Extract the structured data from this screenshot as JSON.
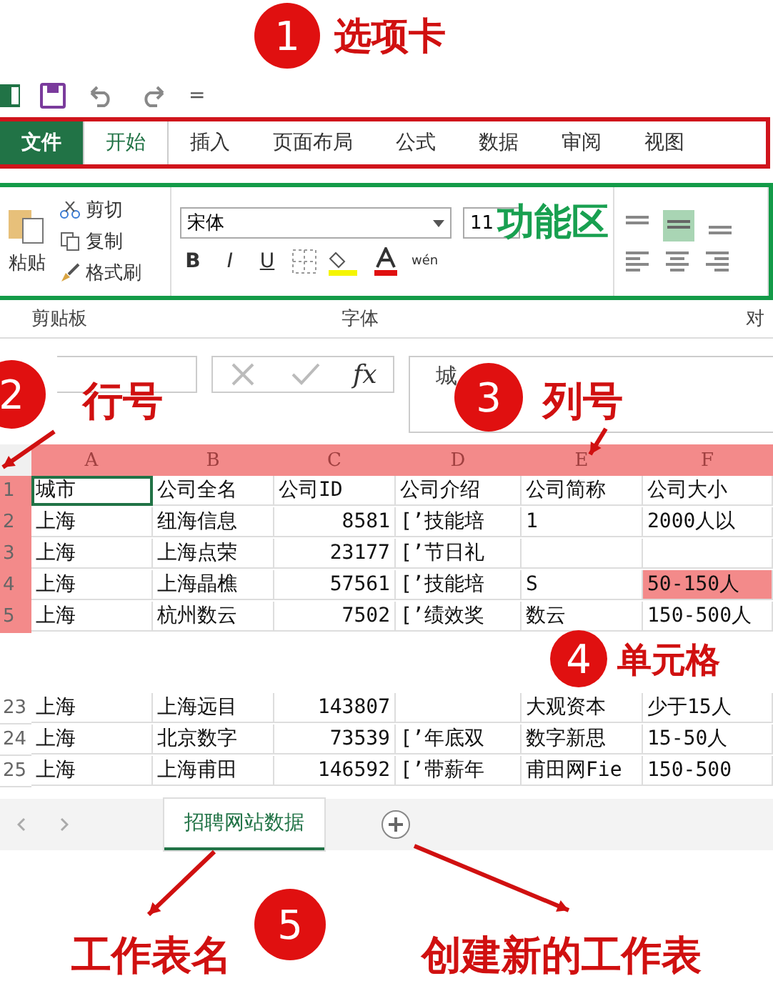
{
  "quick_access": {
    "customize": "="
  },
  "tabs": [
    {
      "label": "文件",
      "kind": "file",
      "selected": false
    },
    {
      "label": "开始",
      "kind": "tab",
      "selected": true
    },
    {
      "label": "插入",
      "kind": "tab",
      "selected": false
    },
    {
      "label": "页面布局",
      "kind": "tab",
      "selected": false
    },
    {
      "label": "公式",
      "kind": "tab",
      "selected": false
    },
    {
      "label": "数据",
      "kind": "tab",
      "selected": false
    },
    {
      "label": "审阅",
      "kind": "tab",
      "selected": false
    },
    {
      "label": "视图",
      "kind": "tab",
      "selected": false
    }
  ],
  "ribbon": {
    "label": "功能区",
    "clipboard": {
      "paste": "粘贴",
      "cut": "剪切",
      "copy": "复制",
      "format_painter": "格式刷"
    },
    "font": {
      "name": "宋体",
      "size": "11",
      "bold": "B",
      "italic": "I",
      "underline": "U",
      "phonetic": "wén"
    },
    "groups": [
      "剪贴板",
      "字体",
      "对"
    ]
  },
  "formula_bar": {
    "function_label": "fx",
    "value": "城"
  },
  "grid": {
    "column_header": {
      "highlighted": true,
      "labels": [
        "A",
        "B",
        "C",
        "D",
        "E",
        "F"
      ]
    },
    "blocks": [
      {
        "highlighted": true,
        "rows": [
          {
            "number": "1",
            "cells": [
              {
                "text": "城市",
                "selected": true,
                "highlighted": false
              },
              {
                "text": "公司全名",
                "selected": false,
                "highlighted": false
              },
              {
                "text": "公司ID",
                "selected": false,
                "highlighted": false
              },
              {
                "text": "公司介绍",
                "selected": false,
                "highlighted": false
              },
              {
                "text": "公司简称",
                "selected": false,
                "highlighted": false
              },
              {
                "text": "公司大小",
                "selected": false,
                "highlighted": false
              }
            ]
          },
          {
            "number": "2",
            "cells": [
              {
                "text": "上海",
                "selected": false,
                "highlighted": false
              },
              {
                "text": "纽海信息",
                "selected": false,
                "highlighted": false
              },
              {
                "text": "8581",
                "selected": false,
                "highlighted": false
              },
              {
                "text": "[’技能培",
                "selected": false,
                "highlighted": false
              },
              {
                "text": "1",
                "selected": false,
                "highlighted": false
              },
              {
                "text": "2000人以",
                "selected": false,
                "highlighted": false
              }
            ]
          },
          {
            "number": "3",
            "cells": [
              {
                "text": "上海",
                "selected": false,
                "highlighted": false
              },
              {
                "text": "上海点荣",
                "selected": false,
                "highlighted": false
              },
              {
                "text": "23177",
                "selected": false,
                "highlighted": false
              },
              {
                "text": "[’节日礼",
                "selected": false,
                "highlighted": false
              },
              {
                "selected": false,
                "highlighted": false
              },
              {
                "selected": false,
                "highlighted": false
              }
            ]
          },
          {
            "number": "4",
            "cells": [
              {
                "text": "上海",
                "selected": false,
                "highlighted": false
              },
              {
                "text": "上海晶樵",
                "selected": false,
                "highlighted": false
              },
              {
                "text": "57561",
                "selected": false,
                "highlighted": false
              },
              {
                "text": "[’技能培",
                "selected": false,
                "highlighted": false
              },
              {
                "text": "S",
                "selected": false,
                "highlighted": false
              },
              {
                "text": "50-150人",
                "selected": false,
                "highlighted": true
              }
            ]
          },
          {
            "number": "5",
            "cells": [
              {
                "text": "上海",
                "selected": false,
                "highlighted": false
              },
              {
                "text": "杭州数云",
                "selected": false,
                "highlighted": false
              },
              {
                "text": "7502",
                "selected": false,
                "highlighted": false
              },
              {
                "text": "[’绩效奖",
                "selected": false,
                "highlighted": false
              },
              {
                "text": "数云",
                "selected": false,
                "highlighted": false
              },
              {
                "text": "150-500人",
                "selected": false,
                "highlighted": false
              }
            ]
          }
        ]
      },
      {
        "highlighted": false,
        "rows": [
          {
            "number": "23",
            "cells": [
              {
                "text": "上海",
                "selected": false,
                "highlighted": false
              },
              {
                "text": "上海远目",
                "selected": false,
                "highlighted": false
              },
              {
                "text": "143807",
                "selected": false,
                "highlighted": false
              },
              {
                "selected": false,
                "highlighted": false
              },
              {
                "text": "大观资本",
                "selected": false,
                "highlighted": false
              },
              {
                "text": "少于15人",
                "selected": false,
                "highlighted": false
              }
            ]
          },
          {
            "number": "24",
            "cells": [
              {
                "text": "上海",
                "selected": false,
                "highlighted": false
              },
              {
                "text": "北京数字",
                "selected": false,
                "highlighted": false
              },
              {
                "text": "73539",
                "selected": false,
                "highlighted": false
              },
              {
                "text": "[’年底双",
                "selected": false,
                "highlighted": false
              },
              {
                "text": "数字新思",
                "selected": false,
                "highlighted": false
              },
              {
                "text": "15-50人",
                "selected": false,
                "highlighted": false
              }
            ]
          },
          {
            "number": "25",
            "cells": [
              {
                "text": "上海",
                "selected": false,
                "highlighted": false
              },
              {
                "text": "上海甫田",
                "selected": false,
                "highlighted": false
              },
              {
                "text": "146592",
                "selected": false,
                "highlighted": false
              },
              {
                "text": "[’带薪年",
                "selected": false,
                "highlighted": false
              },
              {
                "text": "甫田网Fie",
                "selected": false,
                "highlighted": false
              },
              {
                "text": "150-500",
                "selected": false,
                "highlighted": false
              }
            ]
          }
        ]
      }
    ]
  },
  "sheet_tabs": [
    {
      "label": "招聘网站数据",
      "selected": true
    }
  ],
  "callouts": [
    {
      "number": "1",
      "labels": [
        "选项卡"
      ]
    },
    {
      "number": "2",
      "labels": [
        "行号"
      ]
    },
    {
      "number": "3",
      "labels": [
        "列号"
      ]
    },
    {
      "number": "4",
      "labels": [
        "单元格"
      ]
    },
    {
      "number": "5",
      "labels": [
        "工作表名",
        "创建新的工作表"
      ]
    }
  ]
}
